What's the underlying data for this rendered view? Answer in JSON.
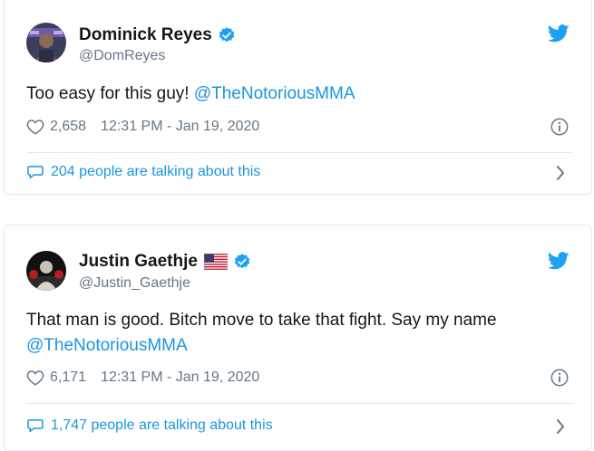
{
  "tweets": [
    {
      "display_name": "Dominick Reyes",
      "handle": "@DomReyes",
      "text_before": "Too easy for this guy! ",
      "mention": "@TheNotoriousMMA",
      "likes": "2,658",
      "timestamp": "12:31 PM - Jan 19, 2020",
      "talking": "204 people are talking about this",
      "verified": true,
      "flag": "",
      "avatar_icon": "avatar-photo"
    },
    {
      "display_name": "Justin Gaethje",
      "handle": "@Justin_Gaethje",
      "text_before": "That man is good. Bitch move to take that fight. Say my name",
      "mention": "@TheNotoriousMMA",
      "likes": "6,171",
      "timestamp": "12:31 PM - Jan 19, 2020",
      "talking": "1,747 people are talking about this",
      "verified": true,
      "flag": "us-flag-icon",
      "avatar_icon": "avatar-photo"
    }
  ],
  "icons": {
    "platform": "twitter-bird-icon",
    "like": "heart-icon",
    "info": "info-icon",
    "reply": "speech-bubble-icon",
    "more": "chevron-right-icon",
    "verified": "verified-badge-icon"
  },
  "colors": {
    "brand": "#1da1f2",
    "link": "#1b95e0",
    "text": "#14171a",
    "muted": "#657786",
    "border": "#e1e8ed"
  }
}
